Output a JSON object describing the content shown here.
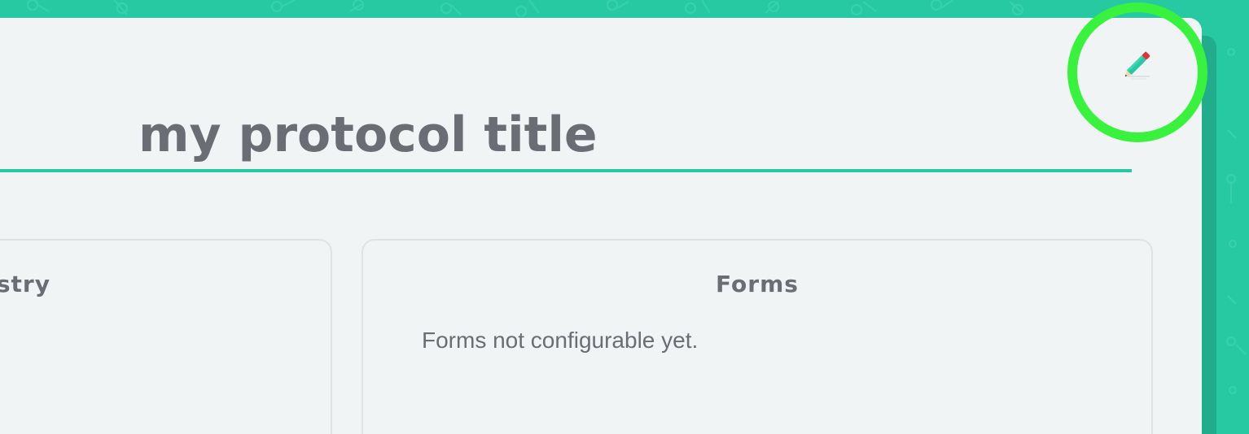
{
  "protocol": {
    "title": "my protocol title"
  },
  "panels": {
    "left": {
      "heading": "stry"
    },
    "forms": {
      "heading": "Forms",
      "message": "Forms not configurable yet."
    }
  },
  "toolbar": {
    "edit_icon": "pencil-icon"
  },
  "colors": {
    "accent": "#26c9a2",
    "accent_dark": "#21ad8c",
    "card_background": "#f0f4f5",
    "text": "#6a6d73",
    "highlight_ring": "#39f23d",
    "pencil_body": "#26c9a2",
    "pencil_eraser": "#e0313b"
  }
}
